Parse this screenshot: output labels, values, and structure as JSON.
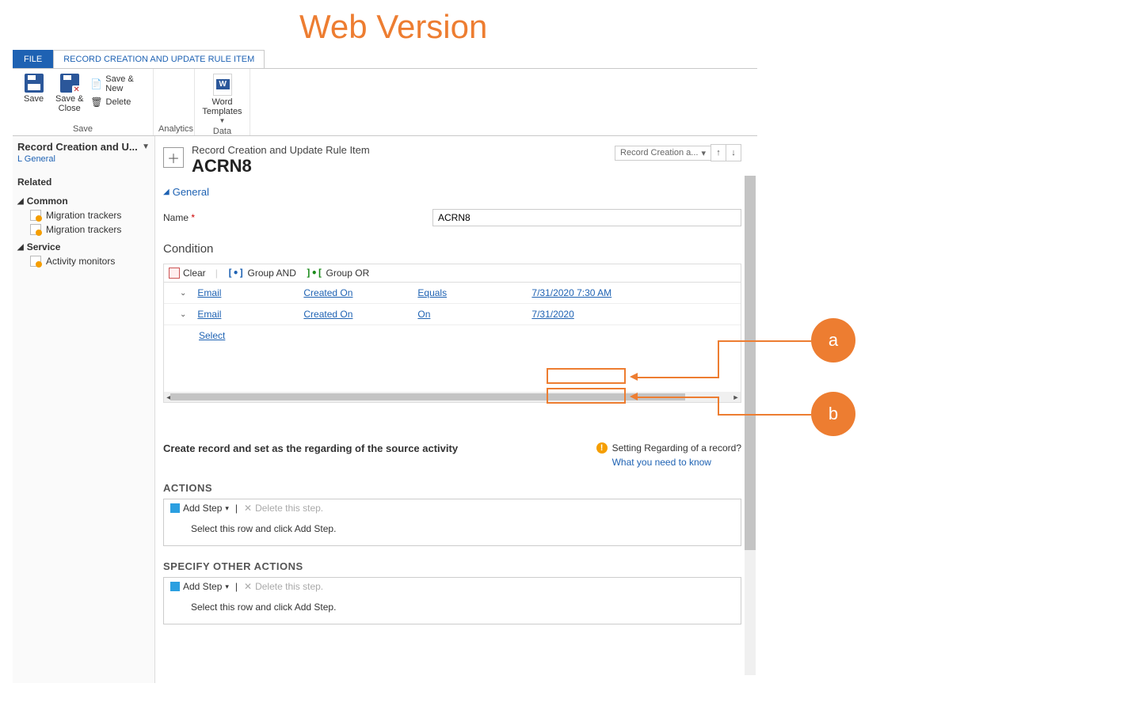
{
  "annotation": {
    "title": "Web Version",
    "a": "a",
    "b": "b"
  },
  "tabs": {
    "file": "FILE",
    "main": "RECORD CREATION AND UPDATE RULE ITEM"
  },
  "ribbon": {
    "save_group": "Save",
    "save": "Save",
    "save_close": "Save &\nClose",
    "save_new": "Save & New",
    "delete": "Delete",
    "analytics_group": "Analytics",
    "data_group": "Data",
    "word_templates": "Word\nTemplates"
  },
  "sidebar": {
    "title": "Record Creation and U...",
    "general_link": "L General",
    "related": "Related",
    "groups": [
      {
        "label": "Common",
        "items": [
          "Migration trackers",
          "Migration trackers"
        ]
      },
      {
        "label": "Service",
        "items": [
          "Activity monitors"
        ]
      }
    ]
  },
  "header": {
    "type": "Record Creation and Update Rule Item",
    "title": "ACRN8",
    "nav_dd": "Record Creation a..."
  },
  "general": {
    "section": "General",
    "name_label": "Name",
    "name_value": "ACRN8"
  },
  "condition": {
    "title": "Condition",
    "clear": "Clear",
    "group_and": "Group AND",
    "group_or": "Group OR",
    "rows": [
      {
        "entity": "Email",
        "attr": "Created On",
        "op": "Equals",
        "val": "7/31/2020 7:30 AM"
      },
      {
        "entity": "Email",
        "attr": "Created On",
        "op": "On",
        "val": "7/31/2020"
      }
    ],
    "select": "Select"
  },
  "create": {
    "label": "Create record and set as the regarding of the source activity",
    "info_q": "Setting Regarding of a record?",
    "info_link": "What you need to know"
  },
  "actions": {
    "title": "ACTIONS",
    "add_step": "Add Step",
    "delete_step": "Delete this step.",
    "placeholder": "Select this row and click Add Step."
  },
  "other": {
    "title": "SPECIFY OTHER ACTIONS",
    "add_step": "Add Step",
    "delete_step": "Delete this step.",
    "placeholder": "Select this row and click Add Step."
  }
}
